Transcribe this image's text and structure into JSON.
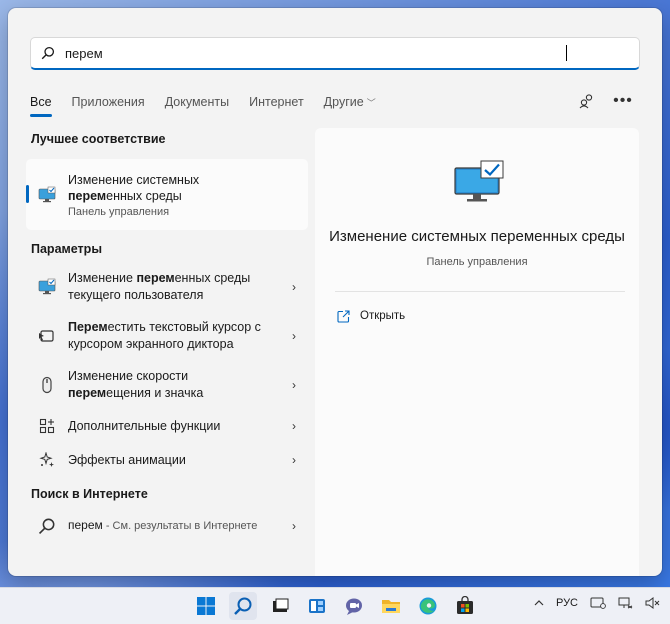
{
  "search": {
    "value": "перем",
    "placeholder": ""
  },
  "tabs": [
    {
      "label": "Все"
    },
    {
      "label": "Приложения"
    },
    {
      "label": "Документы"
    },
    {
      "label": "Интернет"
    },
    {
      "label": "Другие"
    }
  ],
  "best_match": {
    "heading": "Лучшее соответствие",
    "title_line1": "Изменение системных",
    "title_bold": "перем",
    "title_line2_rest": "енных среды",
    "subtitle": "Панель управления"
  },
  "settings": {
    "heading": "Параметры",
    "items": [
      {
        "pre": "Изменение ",
        "bold": "перем",
        "post": "енных среды",
        "line2": "текущего пользователя",
        "icon": "monitor-icon"
      },
      {
        "pre": "",
        "bold": "Перем",
        "post": "естить текстовый курсор с",
        "line2": "курсором экранного диктора",
        "icon": "narrator-cursor-icon"
      },
      {
        "pre": "Изменение скорости",
        "bold": "",
        "post": "",
        "line2_bold": "перем",
        "line2": "ещения и значка",
        "icon": "mouse-icon"
      },
      {
        "pre": "Дополнительные функции",
        "bold": "",
        "post": "",
        "line2": "",
        "icon": "add-features-icon"
      },
      {
        "pre": "Эффекты анимации",
        "bold": "",
        "post": "",
        "line2": "",
        "icon": "animation-effects-icon"
      }
    ]
  },
  "web": {
    "heading": "Поиск в Интернете",
    "query": "перем",
    "hint": " - См. результаты в Интернете"
  },
  "preview": {
    "title": "Изменение системных переменных среды",
    "subtitle": "Панель управления",
    "action_open": "Открыть"
  },
  "taskbar": {
    "language": "РУС",
    "icons": [
      "windows-start-icon",
      "search-icon",
      "task-view-icon",
      "widgets-icon",
      "chat-icon",
      "file-explorer-icon",
      "edge-icon",
      "store-icon"
    ]
  },
  "colors": {
    "accent": "#0067c0"
  }
}
